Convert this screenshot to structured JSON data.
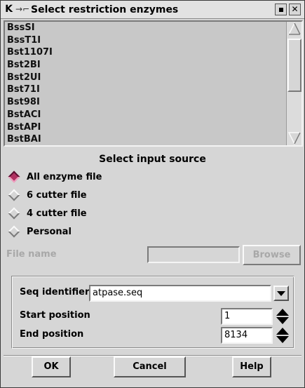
{
  "window": {
    "title": "Select restriction enzymes",
    "menu_icon": "K",
    "pin_icon": "→⌐"
  },
  "enzyme_list": {
    "items": [
      "BssSI",
      "BssT1I",
      "Bst1107I",
      "Bst2BI",
      "Bst2UI",
      "Bst71I",
      "Bst98I",
      "BstACI",
      "BstAPI",
      "BstBAI"
    ]
  },
  "input_source": {
    "title": "Select input source",
    "options": [
      {
        "label": "All enzyme file",
        "selected": true
      },
      {
        "label": "6 cutter file",
        "selected": false
      },
      {
        "label": "4 cutter file",
        "selected": false
      },
      {
        "label": "Personal",
        "selected": false
      }
    ]
  },
  "file": {
    "label": "File name",
    "value": "",
    "browse_label": "Browse"
  },
  "sequence": {
    "seq_label": "Seq identifier",
    "seq_value": "atpase.seq",
    "start_label": "Start position",
    "start_value": "1",
    "end_label": "End position",
    "end_value": "8134"
  },
  "buttons": {
    "ok": "OK",
    "cancel": "Cancel",
    "help": "Help"
  },
  "colors": {
    "window_bg": "#d6d6d6",
    "list_bg": "#c8c8c8",
    "radio_selected": "#b03060",
    "disabled_text": "#a8a8a8"
  }
}
